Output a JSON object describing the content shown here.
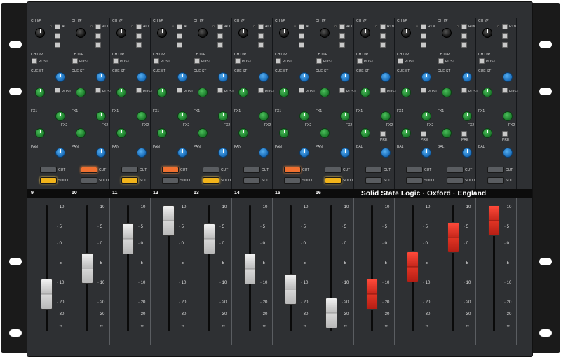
{
  "labels": {
    "ch_ip": "CH I/P",
    "ch_op": "CH O/P",
    "post": "POST",
    "cue_st": "CUE ST",
    "fx1": "FX1",
    "fx2": "FX2",
    "pan": "PAN",
    "bal": "BAL",
    "alt": "ALT",
    "pre": "PRE",
    "rtn": "RTN",
    "cut": "CUT",
    "solo": "SOLO"
  },
  "brand": "Solid State Logic · Oxford · England",
  "colors": {
    "panel": "#2e3033",
    "send_knob": "#1b7a2b",
    "pan_knob": "#1a6cb8",
    "cut_lit": "#f07030",
    "solo_lit": "#f2b41a",
    "fader_cap_mono": "#d0d0d0",
    "fader_cap_stereo": "#d3281c"
  },
  "fader_scale": [
    "10",
    "5",
    "0",
    "5",
    "10",
    "20",
    "30",
    "∞"
  ],
  "channels": [
    {
      "number": "9",
      "type": "mono",
      "cut_lit": false,
      "solo_lit": true,
      "fader_level": 0.3
    },
    {
      "number": "10",
      "type": "mono",
      "cut_lit": true,
      "solo_lit": false,
      "fader_level": 0.55
    },
    {
      "number": "11",
      "type": "mono",
      "cut_lit": false,
      "solo_lit": true,
      "fader_level": 0.83
    },
    {
      "number": "12",
      "type": "mono",
      "cut_lit": true,
      "solo_lit": false,
      "fader_level": 1.0
    },
    {
      "number": "13",
      "type": "mono",
      "cut_lit": false,
      "solo_lit": true,
      "fader_level": 0.83
    },
    {
      "number": "14",
      "type": "mono",
      "cut_lit": false,
      "solo_lit": false,
      "fader_level": 0.54
    },
    {
      "number": "15",
      "type": "mono",
      "cut_lit": true,
      "solo_lit": false,
      "fader_level": 0.35
    },
    {
      "number": "16",
      "type": "mono",
      "cut_lit": false,
      "solo_lit": true,
      "fader_level": 0.12
    },
    {
      "number": "",
      "type": "stereo",
      "cut_lit": false,
      "solo_lit": false,
      "fader_level": 0.3
    },
    {
      "number": "",
      "type": "stereo",
      "cut_lit": false,
      "solo_lit": false,
      "fader_level": 0.56
    },
    {
      "number": "",
      "type": "stereo",
      "cut_lit": false,
      "solo_lit": false,
      "fader_level": 0.84
    },
    {
      "number": "",
      "type": "stereo",
      "cut_lit": false,
      "solo_lit": false,
      "fader_level": 1.0
    }
  ]
}
